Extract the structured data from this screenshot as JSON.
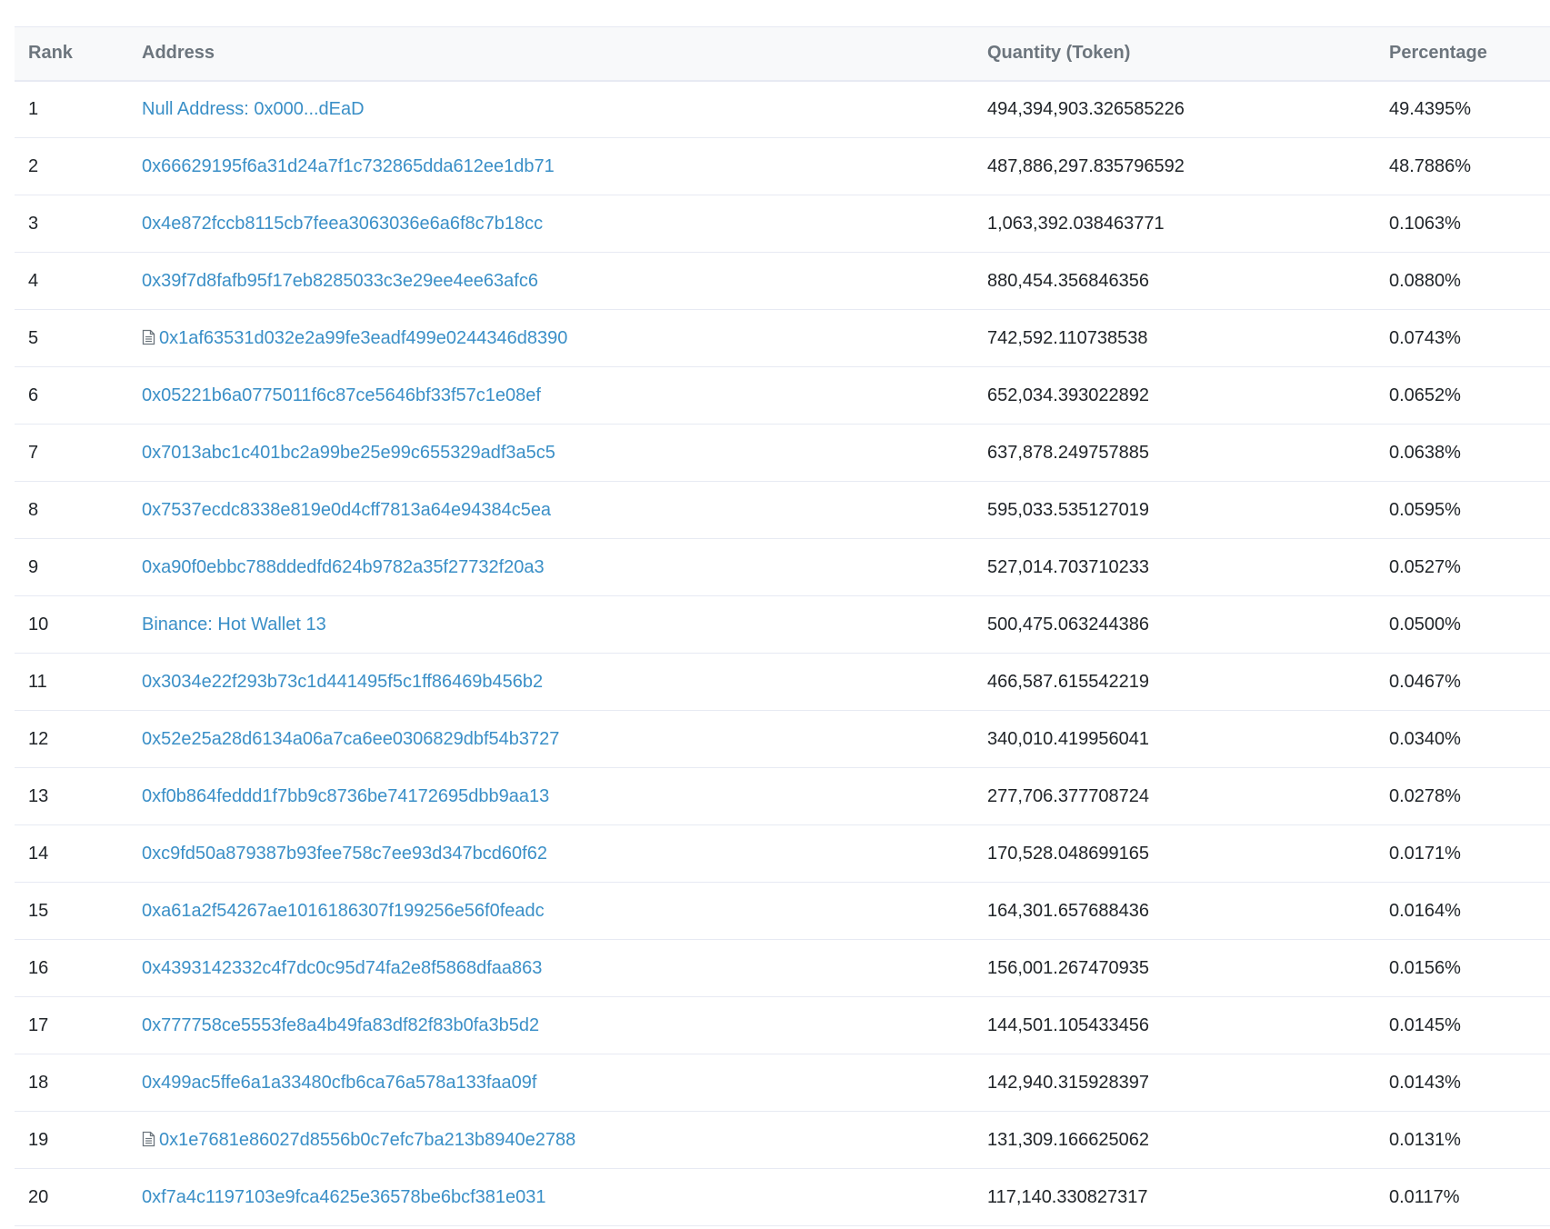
{
  "table": {
    "headers": {
      "rank": "Rank",
      "address": "Address",
      "quantity": "Quantity (Token)",
      "percentage": "Percentage"
    },
    "rows": [
      {
        "rank": "1",
        "address": "Null Address: 0x000...dEaD",
        "contract": false,
        "quantity": "494,394,903.326585226",
        "percentage": "49.4395%"
      },
      {
        "rank": "2",
        "address": "0x66629195f6a31d24a7f1c732865dda612ee1db71",
        "contract": false,
        "quantity": "487,886,297.835796592",
        "percentage": "48.7886%"
      },
      {
        "rank": "3",
        "address": "0x4e872fccb8115cb7feea3063036e6a6f8c7b18cc",
        "contract": false,
        "quantity": "1,063,392.038463771",
        "percentage": "0.1063%"
      },
      {
        "rank": "4",
        "address": "0x39f7d8fafb95f17eb8285033c3e29ee4ee63afc6",
        "contract": false,
        "quantity": "880,454.356846356",
        "percentage": "0.0880%"
      },
      {
        "rank": "5",
        "address": "0x1af63531d032e2a99fe3eadf499e0244346d8390",
        "contract": true,
        "quantity": "742,592.110738538",
        "percentage": "0.0743%"
      },
      {
        "rank": "6",
        "address": "0x05221b6a0775011f6c87ce5646bf33f57c1e08ef",
        "contract": false,
        "quantity": "652,034.393022892",
        "percentage": "0.0652%"
      },
      {
        "rank": "7",
        "address": "0x7013abc1c401bc2a99be25e99c655329adf3a5c5",
        "contract": false,
        "quantity": "637,878.249757885",
        "percentage": "0.0638%"
      },
      {
        "rank": "8",
        "address": "0x7537ecdc8338e819e0d4cff7813a64e94384c5ea",
        "contract": false,
        "quantity": "595,033.535127019",
        "percentage": "0.0595%"
      },
      {
        "rank": "9",
        "address": "0xa90f0ebbc788ddedfd624b9782a35f27732f20a3",
        "contract": false,
        "quantity": "527,014.703710233",
        "percentage": "0.0527%"
      },
      {
        "rank": "10",
        "address": "Binance: Hot Wallet 13",
        "contract": false,
        "quantity": "500,475.063244386",
        "percentage": "0.0500%"
      },
      {
        "rank": "11",
        "address": "0x3034e22f293b73c1d441495f5c1ff86469b456b2",
        "contract": false,
        "quantity": "466,587.615542219",
        "percentage": "0.0467%"
      },
      {
        "rank": "12",
        "address": "0x52e25a28d6134a06a7ca6ee0306829dbf54b3727",
        "contract": false,
        "quantity": "340,010.419956041",
        "percentage": "0.0340%"
      },
      {
        "rank": "13",
        "address": "0xf0b864feddd1f7bb9c8736be74172695dbb9aa13",
        "contract": false,
        "quantity": "277,706.377708724",
        "percentage": "0.0278%"
      },
      {
        "rank": "14",
        "address": "0xc9fd50a879387b93fee758c7ee93d347bcd60f62",
        "contract": false,
        "quantity": "170,528.048699165",
        "percentage": "0.0171%"
      },
      {
        "rank": "15",
        "address": "0xa61a2f54267ae1016186307f199256e56f0feadc",
        "contract": false,
        "quantity": "164,301.657688436",
        "percentage": "0.0164%"
      },
      {
        "rank": "16",
        "address": "0x4393142332c4f7dc0c95d74fa2e8f5868dfaa863",
        "contract": false,
        "quantity": "156,001.267470935",
        "percentage": "0.0156%"
      },
      {
        "rank": "17",
        "address": "0x777758ce5553fe8a4b49fa83df82f83b0fa3b5d2",
        "contract": false,
        "quantity": "144,501.105433456",
        "percentage": "0.0145%"
      },
      {
        "rank": "18",
        "address": "0x499ac5ffe6a1a33480cfb6ca76a578a133faa09f",
        "contract": false,
        "quantity": "142,940.315928397",
        "percentage": "0.0143%"
      },
      {
        "rank": "19",
        "address": "0x1e7681e86027d8556b0c7efc7ba213b8940e2788",
        "contract": true,
        "quantity": "131,309.166625062",
        "percentage": "0.0131%"
      },
      {
        "rank": "20",
        "address": "0xf7a4c1197103e9fca4625e36578be6bcf381e031",
        "contract": false,
        "quantity": "117,140.330827317",
        "percentage": "0.0117%"
      }
    ]
  },
  "icons": {
    "contract": "document-icon"
  },
  "colors": {
    "link": "#3a8fc7",
    "header_text": "#6c757d",
    "header_bg": "#f8f9fa",
    "border": "#e7eaf3"
  }
}
